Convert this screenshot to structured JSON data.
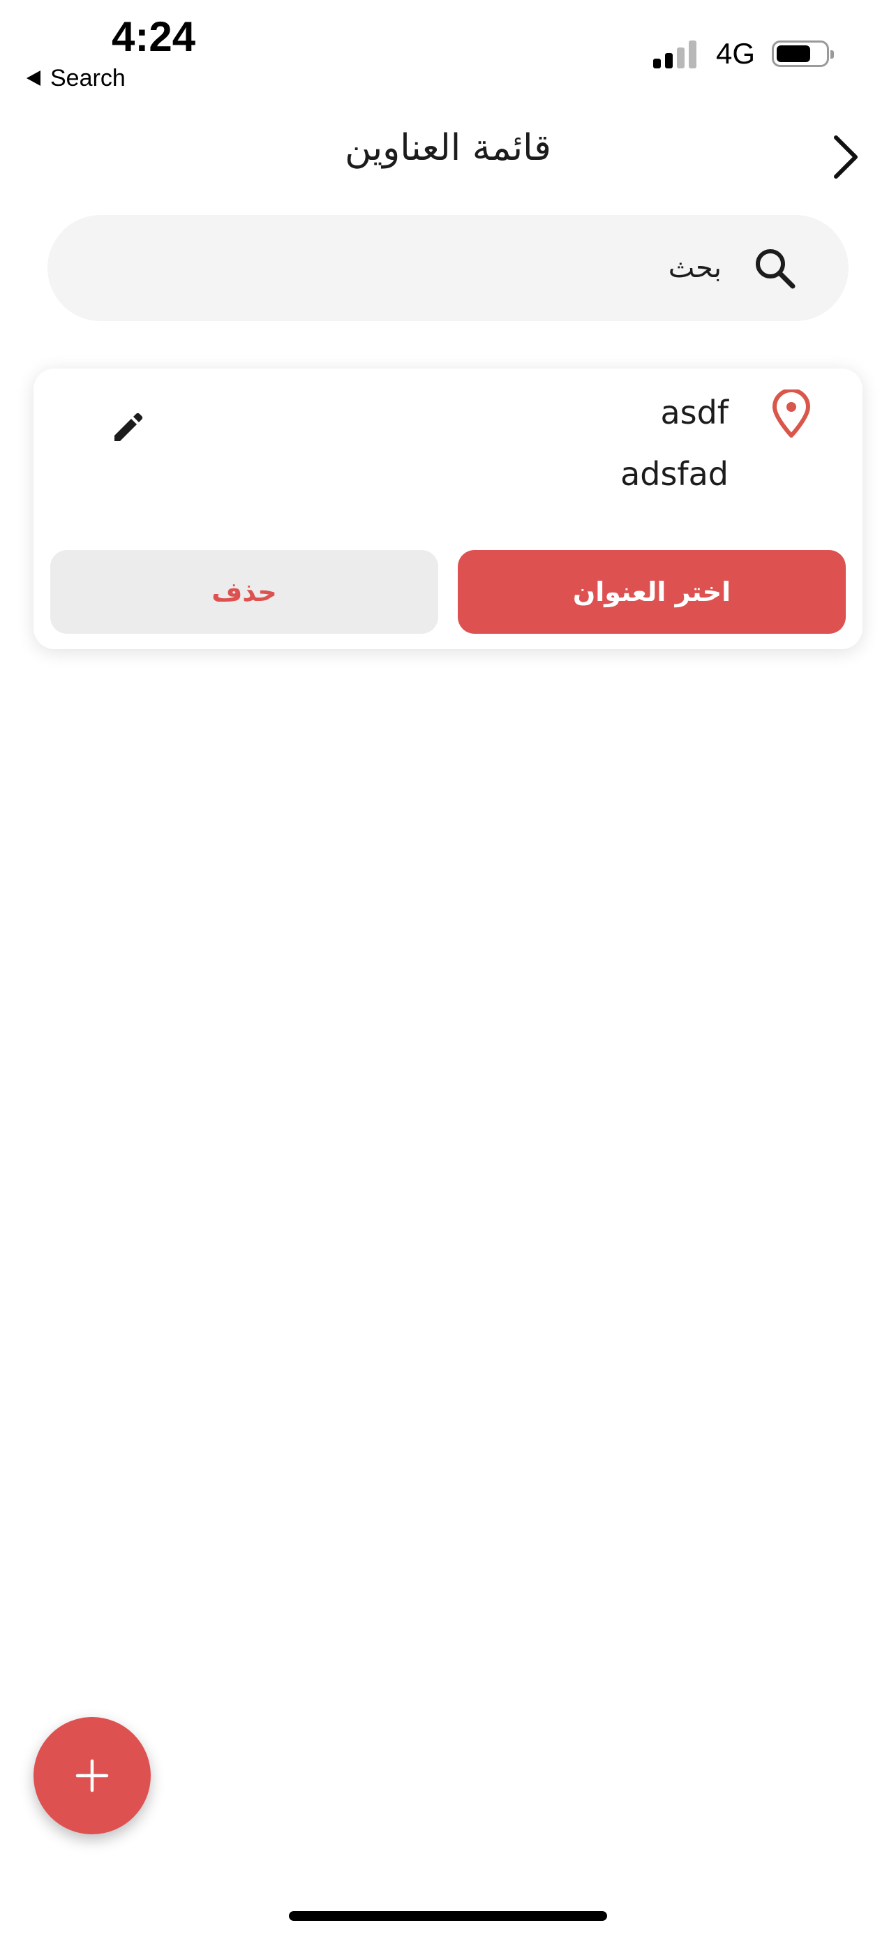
{
  "status_bar": {
    "time": "4:24",
    "back_app_label": "Search",
    "network": "4G",
    "signal_bars_active": 2,
    "signal_bars_total": 4,
    "battery_level": 0.7
  },
  "header": {
    "title": "قائمة العناوين",
    "back_icon": "chevron-right-icon"
  },
  "search": {
    "placeholder": "بحث",
    "value": "",
    "icon": "search-icon"
  },
  "addresses": [
    {
      "name": "asdf",
      "detail": "adsfad",
      "select_label": "اختر العنوان",
      "delete_label": "حذف"
    }
  ],
  "fab": {
    "label": "+",
    "icon": "plus-icon"
  },
  "colors": {
    "accent": "#dd5150",
    "pin": "#d9574a",
    "search_bg": "#f4f4f4",
    "delete_bg": "#ececec",
    "text": "#1c1c1c"
  }
}
